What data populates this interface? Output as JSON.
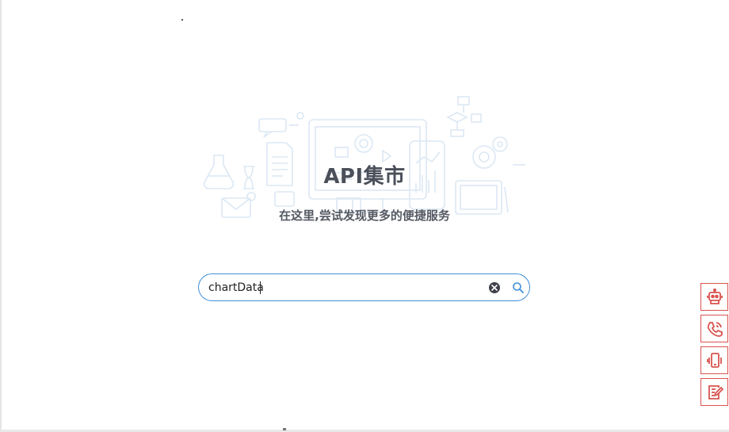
{
  "hero": {
    "title": "API集市",
    "subtitle": "在这里,尝试发现更多的便捷服务"
  },
  "search": {
    "value": "chartData",
    "clear_icon": "clear-circle-icon",
    "search_icon": "search-icon"
  },
  "side_tools": [
    {
      "name": "robot-icon"
    },
    {
      "name": "phone-icon"
    },
    {
      "name": "mobile-device-icon"
    },
    {
      "name": "note-edit-icon"
    }
  ],
  "colors": {
    "accent": "#3f8fd6",
    "side_tool_border": "#d9534f",
    "title_text": "#4a4f5a"
  }
}
